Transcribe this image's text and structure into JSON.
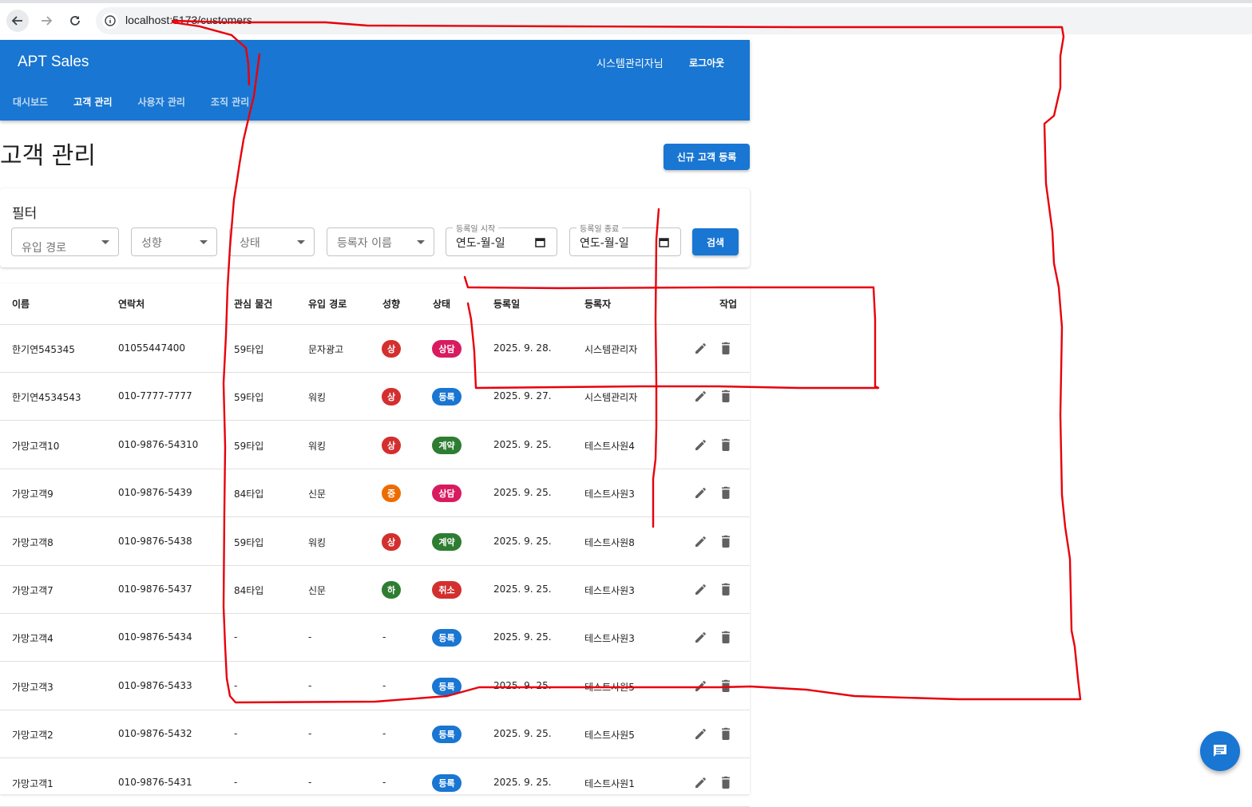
{
  "browser": {
    "url": "localhost:5173/customers"
  },
  "header": {
    "app_title": "APT Sales",
    "user_name": "시스템관리자님",
    "logout_label": "로그아웃",
    "tabs": [
      {
        "label": "대시보드",
        "active": false
      },
      {
        "label": "고객 관리",
        "active": true
      },
      {
        "label": "사용자 관리",
        "active": false
      },
      {
        "label": "조직 관리",
        "active": false
      }
    ]
  },
  "page": {
    "title": "고객 관리",
    "new_customer_label": "신규 고객 등록"
  },
  "filter": {
    "title": "필터",
    "inflow_placeholder": "유입 경로",
    "tendency_placeholder": "성향",
    "status_placeholder": "상태",
    "registrant_placeholder": "등록자 이름",
    "date_start_label": "등록일 시작",
    "date_start_value": "연도-월-일",
    "date_end_label": "등록일 종료",
    "date_end_value": "연도-월-일",
    "search_label": "검색"
  },
  "table": {
    "headers": [
      "이름",
      "연락처",
      "관심 물건",
      "유입 경로",
      "성향",
      "상태",
      "등록일",
      "등록자",
      "작업"
    ],
    "rows": [
      {
        "name": "한기연545345",
        "phone": "01055447400",
        "property": "59타입",
        "inflow": "문자광고",
        "tendency": "상",
        "status": "상담",
        "date": "2025. 9. 28.",
        "registrant": "시스템관리자"
      },
      {
        "name": "한기연4534543",
        "phone": "010-7777-7777",
        "property": "59타입",
        "inflow": "워킹",
        "tendency": "상",
        "status": "등록",
        "date": "2025. 9. 27.",
        "registrant": "시스템관리자"
      },
      {
        "name": "가망고객10",
        "phone": "010-9876-54310",
        "property": "59타입",
        "inflow": "워킹",
        "tendency": "상",
        "status": "계약",
        "date": "2025. 9. 25.",
        "registrant": "테스트사원4"
      },
      {
        "name": "가망고객9",
        "phone": "010-9876-5439",
        "property": "84타입",
        "inflow": "신문",
        "tendency": "중",
        "status": "상담",
        "date": "2025. 9. 25.",
        "registrant": "테스트사원3"
      },
      {
        "name": "가망고객8",
        "phone": "010-9876-5438",
        "property": "59타입",
        "inflow": "워킹",
        "tendency": "상",
        "status": "계약",
        "date": "2025. 9. 25.",
        "registrant": "테스트사원8"
      },
      {
        "name": "가망고객7",
        "phone": "010-9876-5437",
        "property": "84타입",
        "inflow": "신문",
        "tendency": "하",
        "status": "취소",
        "date": "2025. 9. 25.",
        "registrant": "테스트사원3"
      },
      {
        "name": "가망고객4",
        "phone": "010-9876-5434",
        "property": "-",
        "inflow": "-",
        "tendency": "-",
        "status": "등록",
        "date": "2025. 9. 25.",
        "registrant": "테스트사원3"
      },
      {
        "name": "가망고객3",
        "phone": "010-9876-5433",
        "property": "-",
        "inflow": "-",
        "tendency": "-",
        "status": "등록",
        "date": "2025. 9. 25.",
        "registrant": "테스트사원5"
      },
      {
        "name": "가망고객2",
        "phone": "010-9876-5432",
        "property": "-",
        "inflow": "-",
        "tendency": "-",
        "status": "등록",
        "date": "2025. 9. 25.",
        "registrant": "테스트사원5"
      },
      {
        "name": "가망고객1",
        "phone": "010-9876-5431",
        "property": "-",
        "inflow": "-",
        "tendency": "-",
        "status": "등록",
        "date": "2025. 9. 25.",
        "registrant": "테스트사원1"
      }
    ]
  },
  "colors": {
    "primary": "#1976d2",
    "tendency": {
      "상": "#d32f2f",
      "중": "#ed6c02",
      "하": "#2e7d32"
    },
    "status": {
      "상담": "#d81b60",
      "등록": "#1976d2",
      "계약": "#2e7d32",
      "취소": "#d32f2f"
    },
    "annotation": "#e8000b"
  },
  "icons": {
    "back": "arrow-left-icon",
    "forward": "arrow-right-icon",
    "reload": "reload-icon",
    "site_info": "info-icon",
    "edit": "pencil-icon",
    "delete": "trash-icon",
    "calendar": "calendar-icon",
    "chat": "chat-icon"
  }
}
